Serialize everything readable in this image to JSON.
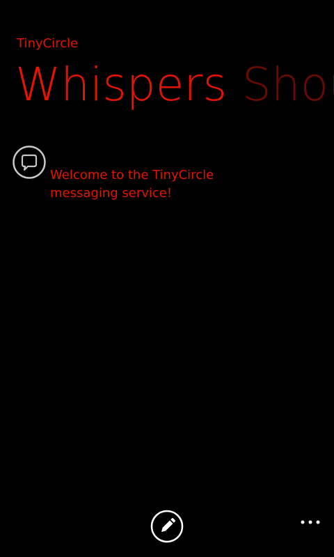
{
  "app": {
    "title": "TinyCircle",
    "accent_color": "#e51400",
    "inactive_header_color": "#6b0a00"
  },
  "pivot": {
    "headers": [
      {
        "label": "Whispers",
        "active": true
      },
      {
        "label": "Shou",
        "active": false
      }
    ]
  },
  "messages": [
    {
      "icon": "chat-bubble-icon",
      "text": "Welcome to the TinyCircle messaging service!"
    }
  ],
  "app_bar": {
    "buttons": [
      {
        "icon": "pencil-icon",
        "name": "compose"
      },
      {
        "icon": "ellipsis-icon",
        "name": "more"
      }
    ]
  }
}
